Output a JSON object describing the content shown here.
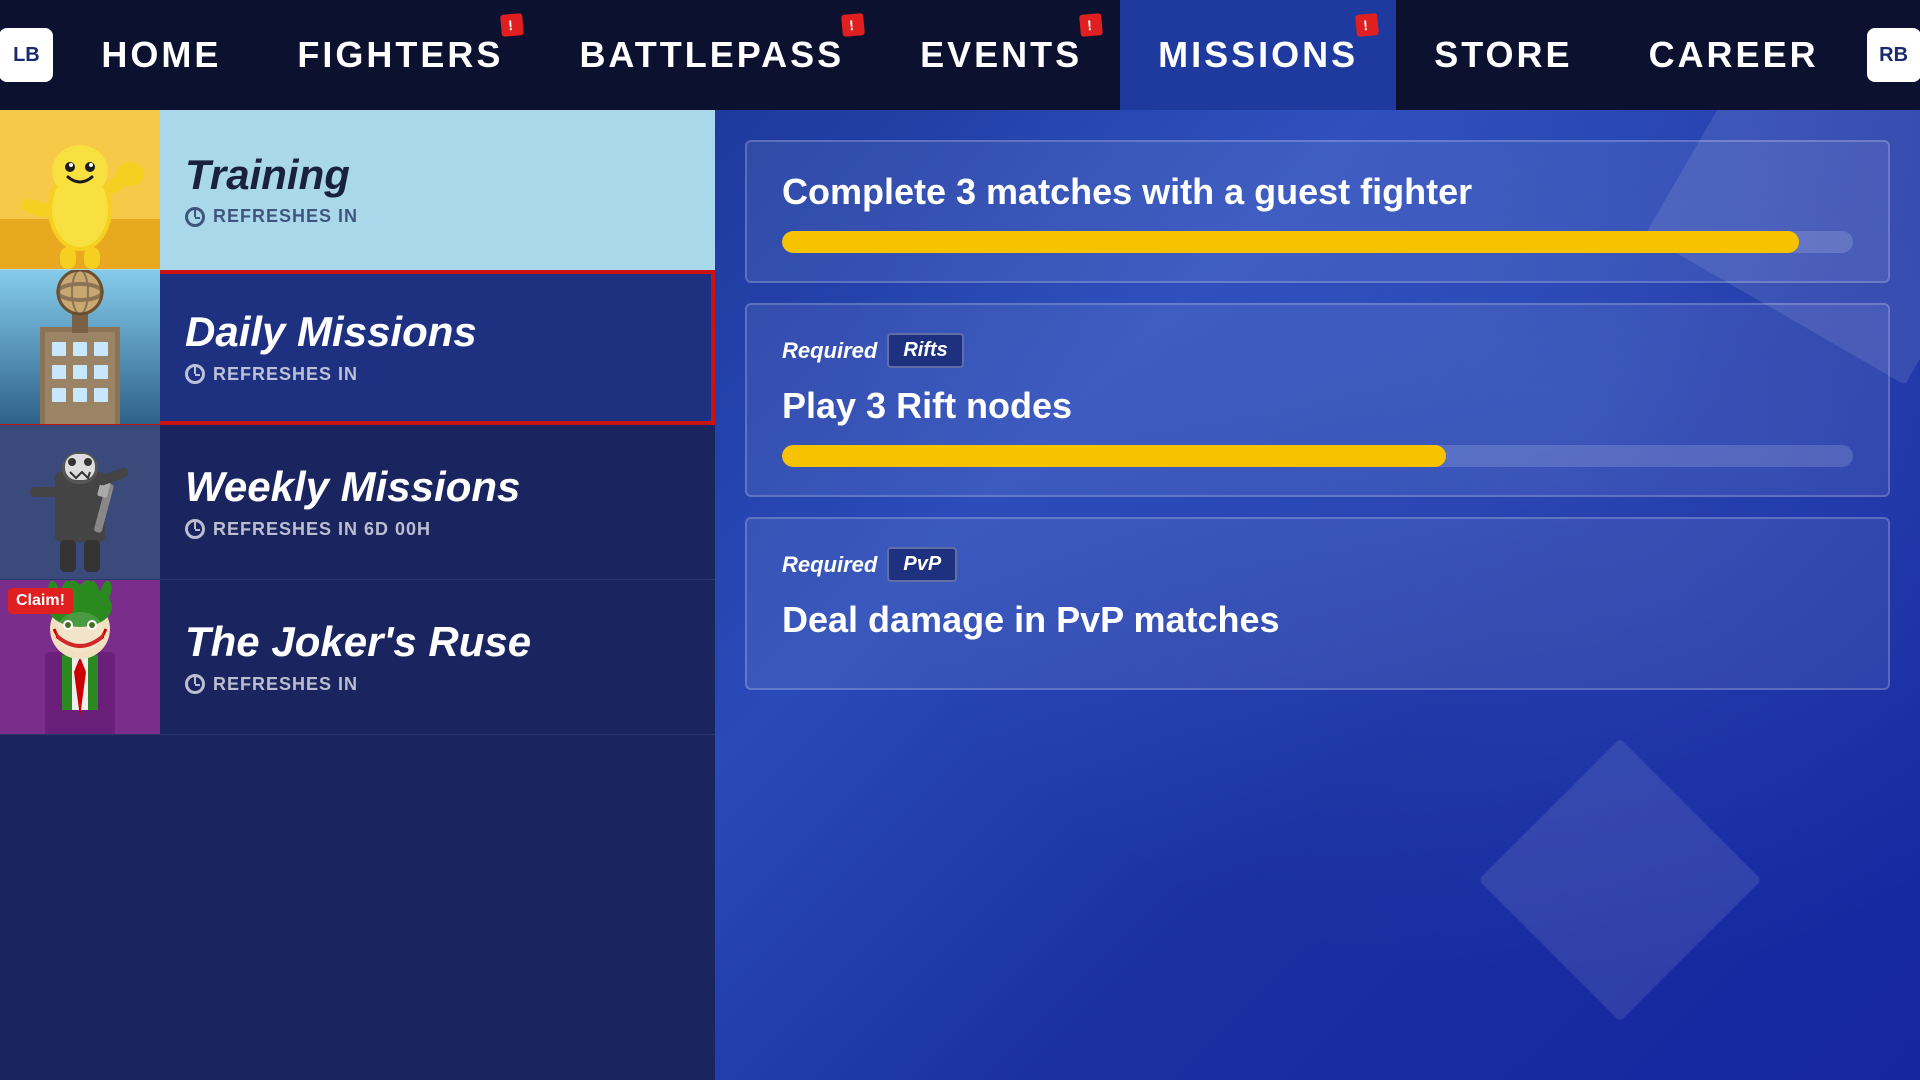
{
  "nav": {
    "left_button": "LB",
    "right_button": "RB",
    "items": [
      {
        "label": "HOME",
        "has_badge": false,
        "active": false
      },
      {
        "label": "FIGHTERS",
        "has_badge": true,
        "badge_text": "!",
        "active": false
      },
      {
        "label": "BATTLEPASS",
        "has_badge": true,
        "badge_text": "!",
        "active": false
      },
      {
        "label": "EVENTS",
        "has_badge": true,
        "badge_text": "!",
        "active": false
      },
      {
        "label": "MISSIONS",
        "has_badge": true,
        "badge_text": "!",
        "active": true
      },
      {
        "label": "STORE",
        "has_badge": false,
        "active": false
      },
      {
        "label": "CAREER",
        "has_badge": false,
        "active": false
      }
    ]
  },
  "mission_list": {
    "items": [
      {
        "id": "training",
        "title": "Training",
        "refresh_text": "REFRESHES IN",
        "selected": false,
        "has_claim": false,
        "type": "training"
      },
      {
        "id": "daily",
        "title": "Daily Missions",
        "refresh_text": "REFRESHES IN",
        "selected": true,
        "has_claim": false,
        "type": "daily"
      },
      {
        "id": "weekly",
        "title": "Weekly Missions",
        "refresh_text": "REFRESHES IN 6d 00h",
        "selected": false,
        "has_claim": false,
        "type": "weekly"
      },
      {
        "id": "joker",
        "title": "The Joker's Ruse",
        "refresh_text": "REFRESHES IN",
        "selected": false,
        "has_claim": true,
        "claim_text": "Claim!",
        "type": "joker"
      }
    ]
  },
  "mission_details": {
    "items": [
      {
        "id": "task1",
        "has_required": false,
        "task_text": "Complete 3 matches with a guest fighter",
        "progress": 95
      },
      {
        "id": "task2",
        "has_required": true,
        "required_label": "Required",
        "tag": "Rifts",
        "task_text": "Play 3 Rift nodes",
        "progress": 62
      },
      {
        "id": "task3",
        "has_required": true,
        "required_label": "Required",
        "tag": "PvP",
        "task_text": "Deal damage in PvP matches",
        "progress": 0,
        "partial": true
      }
    ]
  }
}
